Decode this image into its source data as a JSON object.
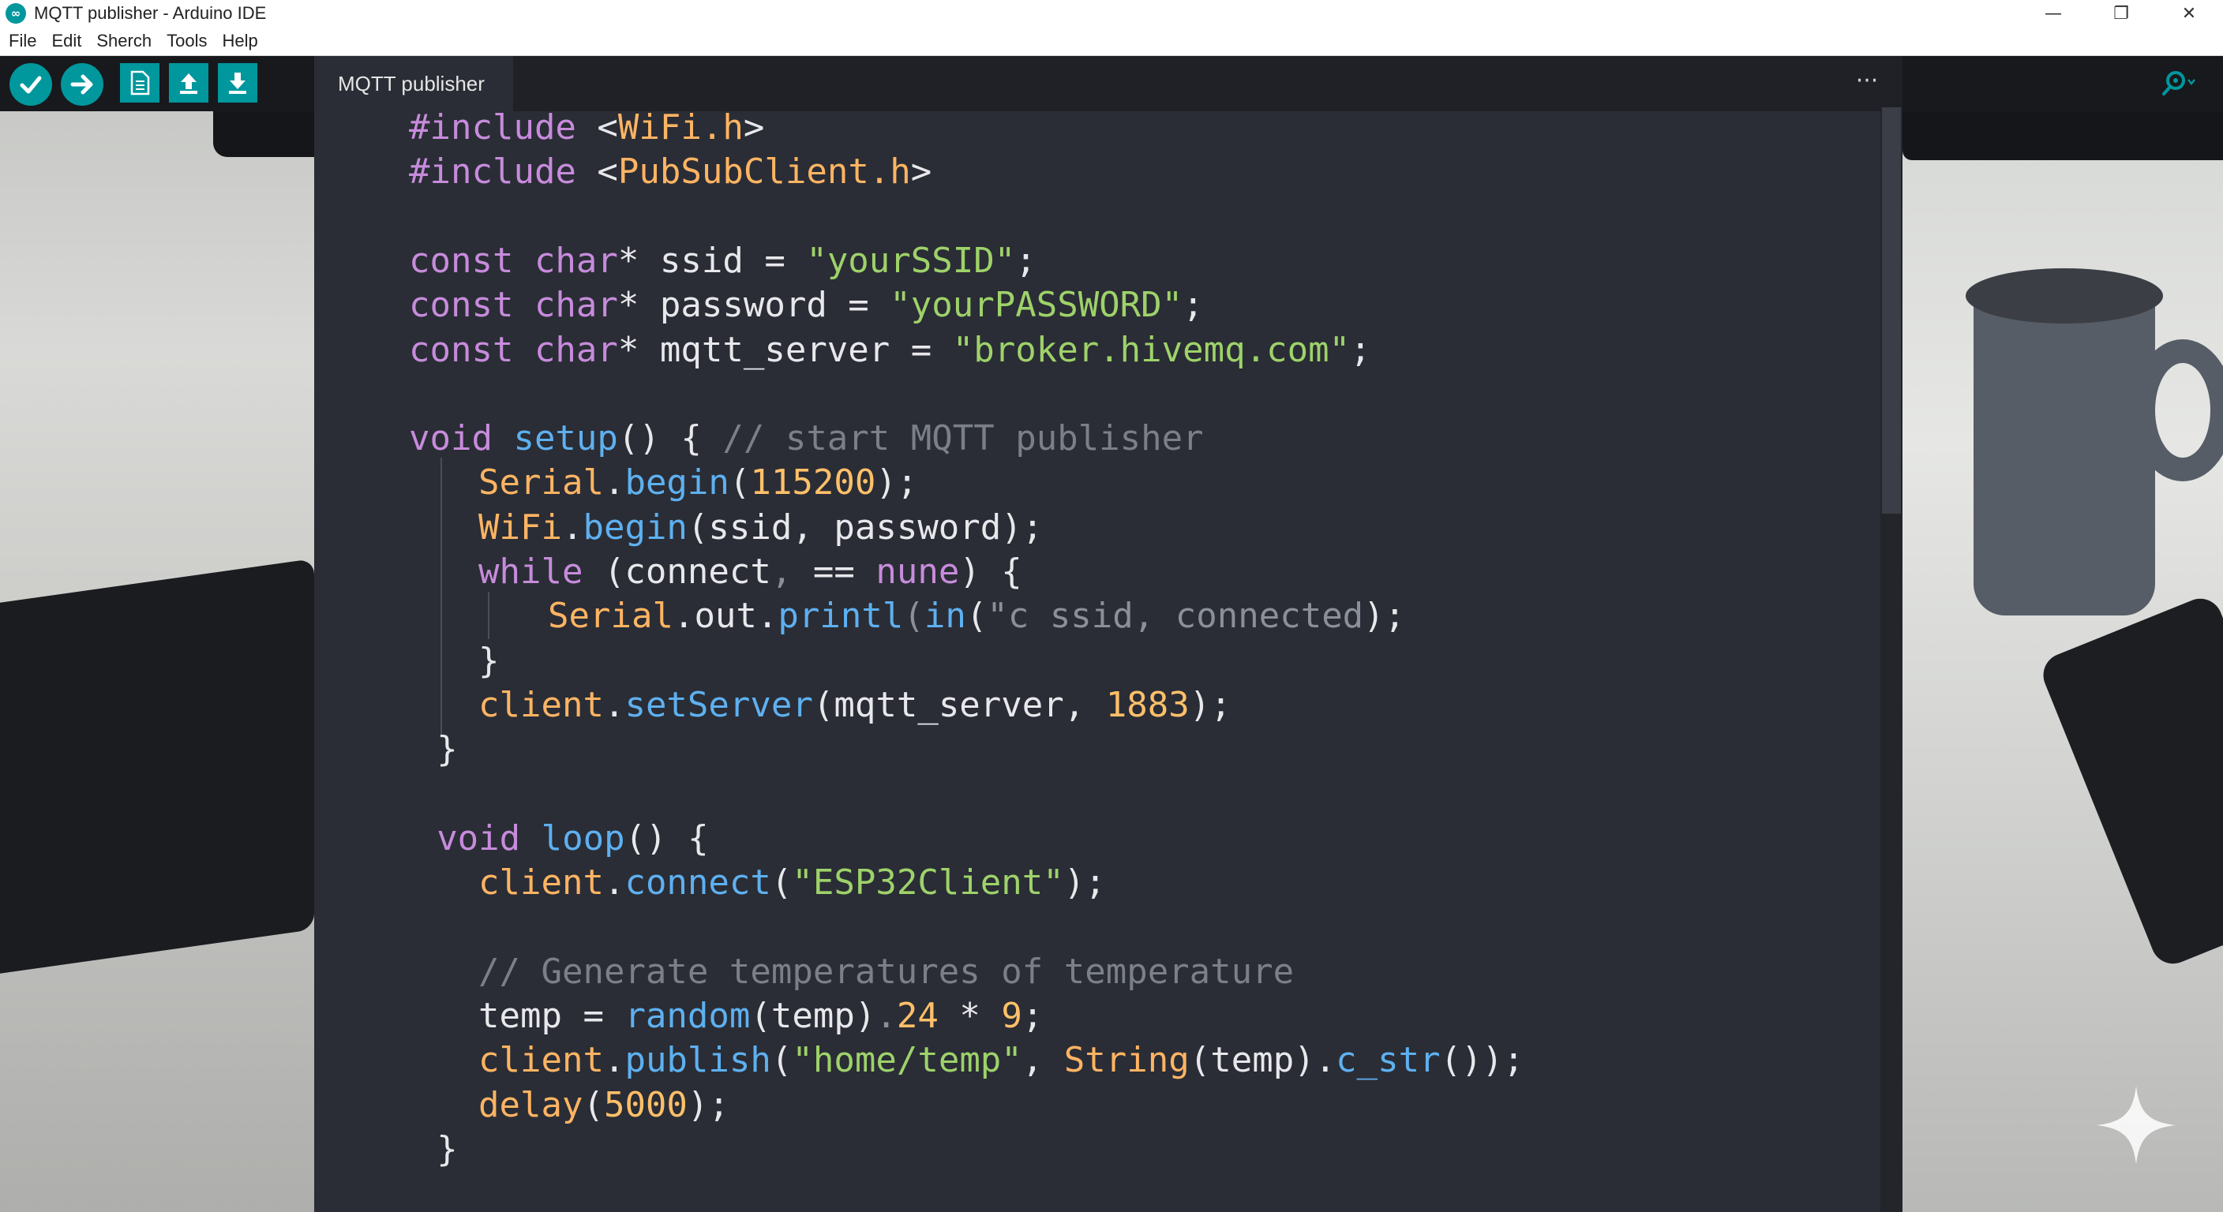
{
  "window": {
    "logo_text": "∞",
    "title": "MQTT publisher - Arduino IDE",
    "controls": [
      "—",
      "❐",
      "✕"
    ]
  },
  "menu": [
    "File",
    "Edit",
    "Sherch",
    "Tools",
    "Help"
  ],
  "toolbar": {
    "buttons": [
      "verify-check-icon",
      "upload-arrow-icon",
      "new-file-icon",
      "open-up-arrow-icon",
      "save-down-arrow-icon"
    ],
    "search_icon": "serial-monitor-magnifier-icon"
  },
  "tab": {
    "label": "MQTT publisher",
    "more": "···"
  },
  "colors": {
    "accent": "#00979d",
    "keyword": "#c78bdc",
    "function": "#5eb0f0",
    "string": "#9ed26a",
    "number": "#ffc069",
    "comment": "#7b7f89"
  },
  "code": [
    {
      "n": "include-wifi",
      "top": 0,
      "indent": 0,
      "tokens": [
        [
          "kw",
          "#include "
        ],
        [
          "plain",
          "<"
        ],
        [
          "hdr",
          "WiFi.h"
        ],
        [
          "plain",
          ">"
        ]
      ]
    },
    {
      "n": "include-pubsub",
      "indent": 0,
      "tokens": [
        [
          "kw",
          "#include "
        ],
        [
          "plain",
          "<"
        ],
        [
          "hdr",
          "PubSubClient.h"
        ],
        [
          "plain",
          ">"
        ]
      ]
    },
    {
      "n": "blank",
      "indent": 0,
      "tokens": []
    },
    {
      "n": "ssid-decl",
      "indent": 0,
      "tokens": [
        [
          "kw",
          "const char"
        ],
        [
          "plain",
          "* ssid = "
        ],
        [
          "str",
          "\"yourSSID\""
        ],
        [
          "plain",
          ";"
        ]
      ]
    },
    {
      "n": "password-decl",
      "indent": 0,
      "tokens": [
        [
          "kw",
          "const char"
        ],
        [
          "plain",
          "* password = "
        ],
        [
          "str",
          "\"yourPASSWORD\""
        ],
        [
          "plain",
          ";"
        ]
      ]
    },
    {
      "n": "server-decl",
      "indent": 0,
      "tokens": [
        [
          "kw",
          "const char"
        ],
        [
          "plain",
          "* mqtt_server = "
        ],
        [
          "str",
          "\"broker.hivemq.com\""
        ],
        [
          "plain",
          ";"
        ]
      ]
    },
    {
      "n": "blank",
      "indent": 0,
      "tokens": []
    },
    {
      "n": "setup-def",
      "indent": 0,
      "tokens": [
        [
          "kw",
          "void "
        ],
        [
          "fn",
          "setup"
        ],
        [
          "plain",
          "() { "
        ],
        [
          "cmt",
          "// start MQTT publisher"
        ]
      ]
    },
    {
      "n": "serial-begin",
      "indent": 1,
      "tokens": [
        [
          "obj",
          "Serial"
        ],
        [
          "plain",
          "."
        ],
        [
          "fn",
          "begin"
        ],
        [
          "plain",
          "("
        ],
        [
          "num",
          "115200"
        ],
        [
          "plain",
          ");"
        ]
      ]
    },
    {
      "n": "wifi-begin",
      "indent": 1,
      "tokens": [
        [
          "obj",
          "WiFi"
        ],
        [
          "plain",
          "."
        ],
        [
          "fn",
          "begin"
        ],
        [
          "plain",
          "(ssid, password);"
        ]
      ]
    },
    {
      "n": "while-loop",
      "indent": 1,
      "tokens": [
        [
          "kw",
          "while"
        ],
        [
          "plain",
          " (connect"
        ],
        [
          "faint",
          ","
        ],
        [
          "plain",
          " == "
        ],
        [
          "kw",
          "nune"
        ],
        [
          "plain",
          ") {"
        ]
      ]
    },
    {
      "n": "serial-print",
      "indent": 2,
      "tokens": [
        [
          "obj",
          "Serial"
        ],
        [
          "plain",
          ".out."
        ],
        [
          "fn",
          "printl"
        ],
        [
          "faint",
          "("
        ],
        [
          "fn",
          "in"
        ],
        [
          "plain",
          "("
        ],
        [
          "faint",
          "\"c ssid, connected"
        ],
        [
          "plain",
          ");"
        ]
      ]
    },
    {
      "n": "while-close",
      "indent": 1,
      "tokens": [
        [
          "plain",
          "}"
        ]
      ]
    },
    {
      "n": "set-server",
      "indent": 1,
      "tokens": [
        [
          "obj",
          "client"
        ],
        [
          "plain",
          "."
        ],
        [
          "fn",
          "setServer"
        ],
        [
          "plain",
          "(mqtt_server, "
        ],
        [
          "num",
          "1883"
        ],
        [
          "plain",
          ");"
        ]
      ]
    },
    {
      "n": "setup-close",
      "indent": 0.4,
      "tokens": [
        [
          "plain",
          "}"
        ]
      ]
    },
    {
      "n": "blank",
      "indent": 0,
      "tokens": []
    },
    {
      "n": "loop-def",
      "indent": 0.4,
      "tokens": [
        [
          "kw",
          "void "
        ],
        [
          "fn",
          "loop"
        ],
        [
          "plain",
          "() {"
        ]
      ]
    },
    {
      "n": "client-connect",
      "indent": 1,
      "tokens": [
        [
          "obj",
          "client"
        ],
        [
          "plain",
          "."
        ],
        [
          "fn",
          "connect"
        ],
        [
          "plain",
          "("
        ],
        [
          "str",
          "\"ESP32Client\""
        ],
        [
          "plain",
          ");"
        ]
      ]
    },
    {
      "n": "blank",
      "indent": 0,
      "tokens": []
    },
    {
      "n": "generate-comment",
      "indent": 1,
      "tokens": [
        [
          "cmt",
          "// Generate temperatures of temperature"
        ]
      ]
    },
    {
      "n": "temp-assign",
      "indent": 1,
      "tokens": [
        [
          "plain",
          "temp = "
        ],
        [
          "fn",
          "random"
        ],
        [
          "plain",
          "(temp)"
        ],
        [
          "faint",
          "."
        ],
        [
          "num",
          "24"
        ],
        [
          "plain",
          " * "
        ],
        [
          "num",
          "9"
        ],
        [
          "plain",
          ";"
        ]
      ]
    },
    {
      "n": "client-publish",
      "indent": 1,
      "tokens": [
        [
          "obj",
          "client"
        ],
        [
          "plain",
          "."
        ],
        [
          "fn",
          "publish"
        ],
        [
          "plain",
          "("
        ],
        [
          "str",
          "\"home/temp\""
        ],
        [
          "plain",
          ", "
        ],
        [
          "obj",
          "String"
        ],
        [
          "plain",
          "(temp)."
        ],
        [
          "fn",
          "c_str"
        ],
        [
          "plain",
          "());"
        ]
      ]
    },
    {
      "n": "delay-call",
      "indent": 1,
      "tokens": [
        [
          "obj",
          "delay"
        ],
        [
          "plain",
          "("
        ],
        [
          "num",
          "5000"
        ],
        [
          "plain",
          ");"
        ]
      ]
    },
    {
      "n": "loop-close",
      "indent": 0.4,
      "tokens": [
        [
          "plain",
          "}"
        ]
      ]
    }
  ]
}
